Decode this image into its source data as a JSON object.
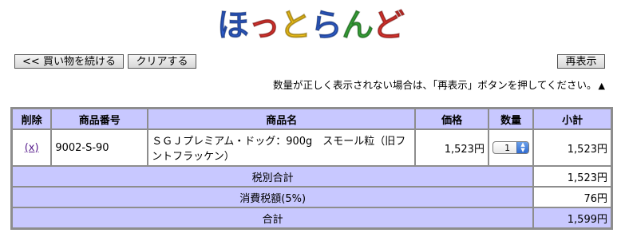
{
  "logo": {
    "text": "ほっとらんど",
    "chars": [
      {
        "ch": "ほ",
        "color": "#2f5fd0"
      },
      {
        "ch": "っ",
        "color": "#e0342f"
      },
      {
        "ch": "と",
        "color": "#f1c21b"
      },
      {
        "ch": "ら",
        "color": "#2f5fd0"
      },
      {
        "ch": "ん",
        "color": "#39a83a"
      },
      {
        "ch": "ど",
        "color": "#e0342f"
      }
    ]
  },
  "toolbar": {
    "back_label": "<< 買い物を続ける",
    "clear_label": "クリアする",
    "refresh_label": "再表示"
  },
  "notice": {
    "text": "数量が正しく表示されない場合は、「再表示」ボタンを押してください。",
    "icon": "▲"
  },
  "table": {
    "headers": {
      "delete": "削除",
      "code": "商品番号",
      "name": "商品名",
      "price": "価格",
      "qty": "数量",
      "subtotal": "小計"
    },
    "items": [
      {
        "delete": "(x)",
        "code": "9002-S-90",
        "name": "ＳＧＪプレミアム・ドッグ：900g　スモール粒（旧フントフラッケン）",
        "price": "1,523円",
        "qty": "1",
        "subtotal": "1,523円"
      }
    ],
    "summary": {
      "pretax_label": "税別合計",
      "pretax_value": "1,523円",
      "tax_label": "消費税額(5%)",
      "tax_value": "76円",
      "total_label": "合計",
      "total_value": "1,599円"
    }
  },
  "colors": {
    "header_bg": "#c8c8ff",
    "border": "#8d8d8d"
  }
}
